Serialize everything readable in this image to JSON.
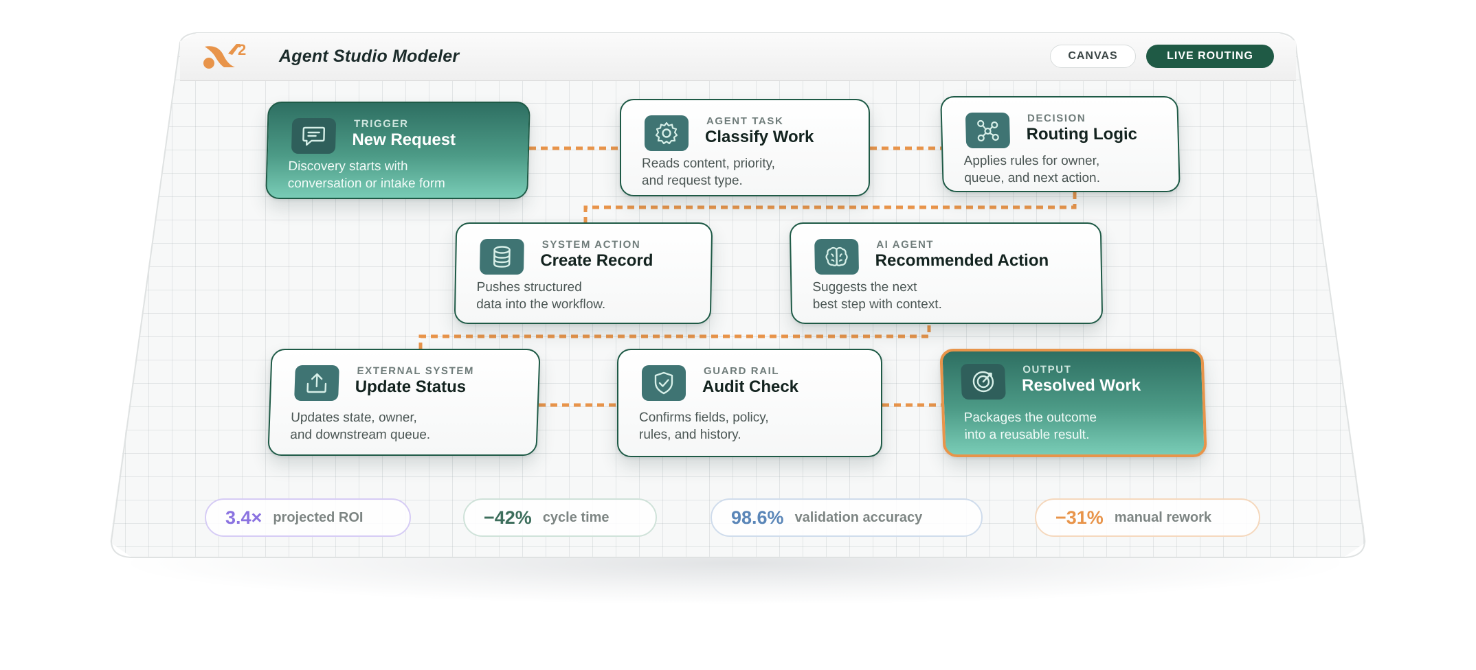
{
  "app": {
    "title": "Agent Studio Modeler",
    "logo_superscript": "2"
  },
  "header": {
    "canvas_label": "CANVAS",
    "live_routing_label": "LIVE ROUTING"
  },
  "colors": {
    "brand_green": "#1f5a45",
    "accent_orange": "#e8944a",
    "teal_icon": "#3f7473",
    "roi_purple": "#8a72e0",
    "cycle_green": "#3d6e5c",
    "accuracy_blue": "#5a86b8",
    "rework_orange": "#e8944a"
  },
  "nodes": {
    "trigger": {
      "kicker": "TRIGGER",
      "title": "New Request",
      "desc_line1": "Discovery starts with",
      "desc_line2": "conversation or intake form",
      "icon": "chat-icon"
    },
    "classify": {
      "kicker": "AGENT TASK",
      "title": "Classify Work",
      "desc_line1": "Reads content, priority,",
      "desc_line2": "and request type.",
      "icon": "gear-icon"
    },
    "routing": {
      "kicker": "DECISION",
      "title": "Routing Logic",
      "desc_line1": "Applies rules for owner,",
      "desc_line2": "queue, and next action.",
      "icon": "network-icon"
    },
    "create_record": {
      "kicker": "SYSTEM ACTION",
      "title": "Create Record",
      "desc_line1": "Pushes structured",
      "desc_line2": "data into the workflow.",
      "icon": "database-icon"
    },
    "recommended": {
      "kicker": "AI AGENT",
      "title": "Recommended Action",
      "desc_line1": "Suggests the next",
      "desc_line2": "best step with context.",
      "icon": "brain-icon"
    },
    "update_status": {
      "kicker": "EXTERNAL SYSTEM",
      "title": "Update Status",
      "desc_line1": "Updates state, owner,",
      "desc_line2": "and downstream queue.",
      "icon": "upload-icon"
    },
    "audit": {
      "kicker": "GUARD RAIL",
      "title": "Audit Check",
      "desc_line1": "Confirms fields, policy,",
      "desc_line2": "rules, and history.",
      "icon": "shield-check-icon"
    },
    "output": {
      "kicker": "OUTPUT",
      "title": "Resolved Work",
      "desc_line1": "Packages the outcome",
      "desc_line2": "into a reusable result.",
      "icon": "target-icon"
    }
  },
  "metrics": {
    "roi": {
      "value": "3.4×",
      "label": "projected ROI"
    },
    "cycle": {
      "value": "−42%",
      "label": "cycle time"
    },
    "accuracy": {
      "value": "98.6%",
      "label": "validation accuracy"
    },
    "rework": {
      "value": "−31%",
      "label": "manual rework"
    }
  }
}
